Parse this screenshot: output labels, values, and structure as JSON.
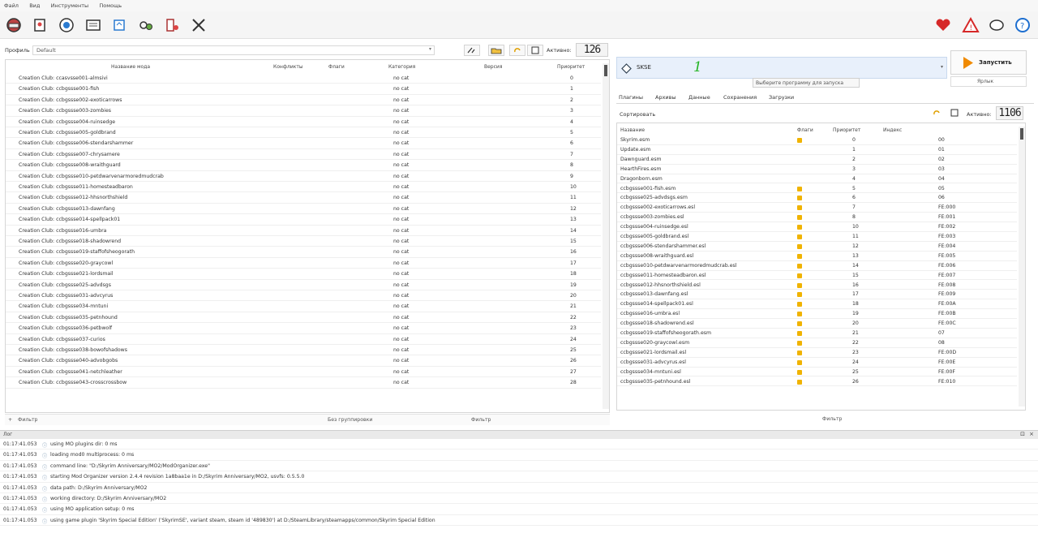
{
  "menu": [
    "Файл",
    "Вид",
    "Инструменты",
    "Помощь"
  ],
  "profile": {
    "label": "Профиль",
    "value": "Default",
    "active_label": "Активно:",
    "active_count": "126"
  },
  "mods": {
    "columns": [
      "Название мода",
      "Конфликты",
      "Флаги",
      "Категория",
      "Версия",
      "Приоритет"
    ],
    "rows": [
      {
        "name": "Creation Club: ccasvsse001-almsivi",
        "cat": "no cat",
        "prio": "0"
      },
      {
        "name": "Creation Club: ccbgssse001-fish",
        "cat": "no cat",
        "prio": "1"
      },
      {
        "name": "Creation Club: ccbgssse002-exoticarrows",
        "cat": "no cat",
        "prio": "2"
      },
      {
        "name": "Creation Club: ccbgssse003-zombies",
        "cat": "no cat",
        "prio": "3"
      },
      {
        "name": "Creation Club: ccbgssse004-ruinsedge",
        "cat": "no cat",
        "prio": "4"
      },
      {
        "name": "Creation Club: ccbgssse005-goldbrand",
        "cat": "no cat",
        "prio": "5"
      },
      {
        "name": "Creation Club: ccbgssse006-stendarshammer",
        "cat": "no cat",
        "prio": "6"
      },
      {
        "name": "Creation Club: ccbgssse007-chrysamere",
        "cat": "no cat",
        "prio": "7"
      },
      {
        "name": "Creation Club: ccbgssse008-wraithguard",
        "cat": "no cat",
        "prio": "8"
      },
      {
        "name": "Creation Club: ccbgssse010-petdwarvenarmoredmudcrab",
        "cat": "no cat",
        "prio": "9"
      },
      {
        "name": "Creation Club: ccbgssse011-homesteadbaron",
        "cat": "no cat",
        "prio": "10"
      },
      {
        "name": "Creation Club: ccbgssse012-hhsnorthshield",
        "cat": "no cat",
        "prio": "11"
      },
      {
        "name": "Creation Club: ccbgssse013-dawnfang",
        "cat": "no cat",
        "prio": "12"
      },
      {
        "name": "Creation Club: ccbgssse014-spellpack01",
        "cat": "no cat",
        "prio": "13"
      },
      {
        "name": "Creation Club: ccbgssse016-umbra",
        "cat": "no cat",
        "prio": "14"
      },
      {
        "name": "Creation Club: ccbgssse018-shadowrend",
        "cat": "no cat",
        "prio": "15"
      },
      {
        "name": "Creation Club: ccbgssse019-staffofsheogorath",
        "cat": "no cat",
        "prio": "16"
      },
      {
        "name": "Creation Club: ccbgssse020-graycowl",
        "cat": "no cat",
        "prio": "17"
      },
      {
        "name": "Creation Club: ccbgssse021-lordsmail",
        "cat": "no cat",
        "prio": "18"
      },
      {
        "name": "Creation Club: ccbgssse025-advdsgs",
        "cat": "no cat",
        "prio": "19"
      },
      {
        "name": "Creation Club: ccbgssse031-advcyrus",
        "cat": "no cat",
        "prio": "20"
      },
      {
        "name": "Creation Club: ccbgssse034-mntuni",
        "cat": "no cat",
        "prio": "21"
      },
      {
        "name": "Creation Club: ccbgssse035-petnhound",
        "cat": "no cat",
        "prio": "22"
      },
      {
        "name": "Creation Club: ccbgssse036-petbwolf",
        "cat": "no cat",
        "prio": "23"
      },
      {
        "name": "Creation Club: ccbgssse037-curios",
        "cat": "no cat",
        "prio": "24"
      },
      {
        "name": "Creation Club: ccbgssse038-bowofshadows",
        "cat": "no cat",
        "prio": "25"
      },
      {
        "name": "Creation Club: ccbgssse040-advobgobs",
        "cat": "no cat",
        "prio": "26"
      },
      {
        "name": "Creation Club: ccbgssse041-netchleather",
        "cat": "no cat",
        "prio": "27"
      },
      {
        "name": "Creation Club: ccbgssse043-crosscrossbow",
        "cat": "no cat",
        "prio": "28"
      }
    ],
    "filter_label": "Фильтр",
    "groups_label": "Без группировки",
    "filter_name": "Фильтр"
  },
  "executable": {
    "name": "SKSE",
    "badge": "1",
    "tooltip": "Выберите программу для запуска"
  },
  "run": {
    "label": "Запустить",
    "shortcut": "Ярлык"
  },
  "tabs": [
    "Плагины",
    "Архивы",
    "Данные",
    "Сохранения",
    "Загрузки"
  ],
  "plugins": {
    "sort_label": "Сортировать",
    "active_label": "Активно:",
    "active_count": "1106",
    "columns": [
      "Название",
      "Флаги",
      "Приоритет",
      "Индекс"
    ],
    "rows": [
      {
        "name": "Skyrim.esm",
        "flag": true,
        "prio": "0",
        "idx": "00"
      },
      {
        "name": "Update.esm",
        "flag": false,
        "prio": "1",
        "idx": "01"
      },
      {
        "name": "Dawnguard.esm",
        "flag": false,
        "prio": "2",
        "idx": "02"
      },
      {
        "name": "HearthFires.esm",
        "flag": false,
        "prio": "3",
        "idx": "03"
      },
      {
        "name": "Dragonborn.esm",
        "flag": false,
        "prio": "4",
        "idx": "04"
      },
      {
        "name": "ccbgssse001-fish.esm",
        "flag": true,
        "prio": "5",
        "idx": "05"
      },
      {
        "name": "ccbgssse025-advdsgs.esm",
        "flag": true,
        "prio": "6",
        "idx": "06"
      },
      {
        "name": "ccbgssse002-exoticarrows.esl",
        "flag": true,
        "prio": "7",
        "idx": "FE:000"
      },
      {
        "name": "ccbgssse003-zombies.esl",
        "flag": true,
        "prio": "8",
        "idx": "FE:001"
      },
      {
        "name": "ccbgssse004-ruinsedge.esl",
        "flag": true,
        "prio": "10",
        "idx": "FE:002"
      },
      {
        "name": "ccbgssse005-goldbrand.esl",
        "flag": true,
        "prio": "11",
        "idx": "FE:003"
      },
      {
        "name": "ccbgssse006-stendarshammer.esl",
        "flag": true,
        "prio": "12",
        "idx": "FE:004"
      },
      {
        "name": "ccbgssse008-wraithguard.esl",
        "flag": true,
        "prio": "13",
        "idx": "FE:005"
      },
      {
        "name": "ccbgssse010-petdwarvenarmoredmudcrab.esl",
        "flag": true,
        "prio": "14",
        "idx": "FE:006"
      },
      {
        "name": "ccbgssse011-homesteadbaron.esl",
        "flag": true,
        "prio": "15",
        "idx": "FE:007"
      },
      {
        "name": "ccbgssse012-hhsnorthshield.esl",
        "flag": true,
        "prio": "16",
        "idx": "FE:008"
      },
      {
        "name": "ccbgssse013-dawnfang.esl",
        "flag": true,
        "prio": "17",
        "idx": "FE:009"
      },
      {
        "name": "ccbgssse014-spellpack01.esl",
        "flag": true,
        "prio": "18",
        "idx": "FE:00A"
      },
      {
        "name": "ccbgssse016-umbra.esl",
        "flag": true,
        "prio": "19",
        "idx": "FE:00B"
      },
      {
        "name": "ccbgssse018-shadowrend.esl",
        "flag": true,
        "prio": "20",
        "idx": "FE:00C"
      },
      {
        "name": "ccbgssse019-staffofsheogorath.esm",
        "flag": true,
        "prio": "21",
        "idx": "07"
      },
      {
        "name": "ccbgssse020-graycowl.esm",
        "flag": true,
        "prio": "22",
        "idx": "08"
      },
      {
        "name": "ccbgssse021-lordsmail.esl",
        "flag": true,
        "prio": "23",
        "idx": "FE:00D"
      },
      {
        "name": "ccbgssse031-advcyrus.esl",
        "flag": true,
        "prio": "24",
        "idx": "FE:00E"
      },
      {
        "name": "ccbgssse034-mntuni.esl",
        "flag": true,
        "prio": "25",
        "idx": "FE:00F"
      },
      {
        "name": "ccbgssse035-petnhound.esl",
        "flag": true,
        "prio": "26",
        "idx": "FE:010"
      }
    ],
    "filter_name": "Фильтр"
  },
  "log": {
    "title": "Лог",
    "rows": [
      {
        "time": "01:17:41.053",
        "text": "using MO plugins dir: 0 ms"
      },
      {
        "time": "01:17:41.053",
        "text": "loading mod0 multiprocess: 0 ms"
      },
      {
        "time": "01:17:41.053",
        "text": "command line: \"D:/Skyrim Anniversary/MO2/ModOrganizer.exe\""
      },
      {
        "time": "01:17:41.053",
        "text": "starting Mod Organizer version 2.4.4 revision 1a8baa1e in D:/Skyrim Anniversary/MO2, usvfs: 0.5.5.0"
      },
      {
        "time": "01:17:41.053",
        "text": "data path: D:/Skyrim Anniversary/MO2"
      },
      {
        "time": "01:17:41.053",
        "text": "working directory: D:/Skyrim Anniversary/MO2"
      },
      {
        "time": "01:17:41.053",
        "text": "using MO application setup: 0 ms"
      },
      {
        "time": "01:17:41.053",
        "text": "using game plugin 'Skyrim Special Edition' ('SkyrimSE', variant steam, steam id '489830') at D:/SteamLibrary/steamapps/common/Skyrim Special Edition"
      }
    ]
  },
  "colors": {
    "accent": "#f08a00",
    "heart": "#d62828",
    "warn": "#d62828",
    "help": "#1e6fd0",
    "badge": "#22b422"
  }
}
